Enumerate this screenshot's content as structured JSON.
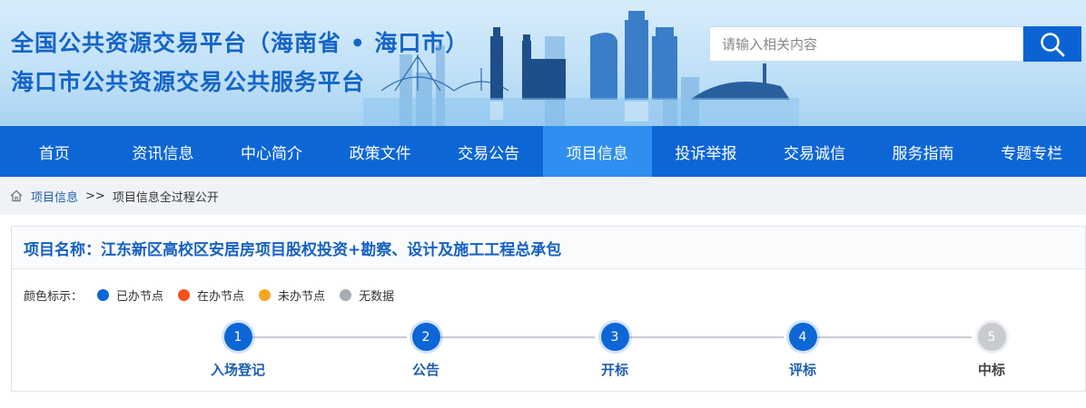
{
  "header": {
    "title_line1": "全国公共资源交易平台（海南省 • 海口市）",
    "title_line2": "海口市公共资源交易公共服务平台",
    "search_placeholder": "请输入相关内容",
    "search_icon": "search-icon"
  },
  "nav": {
    "items": [
      {
        "label": "首页"
      },
      {
        "label": "资讯信息"
      },
      {
        "label": "中心简介"
      },
      {
        "label": "政策文件"
      },
      {
        "label": "交易公告"
      },
      {
        "label": "项目信息",
        "active": true
      },
      {
        "label": "投诉举报"
      },
      {
        "label": "交易诚信"
      },
      {
        "label": "服务指南"
      },
      {
        "label": "专题专栏"
      }
    ]
  },
  "breadcrumb": {
    "home_icon": "home-icon",
    "link": "项目信息",
    "separator": ">>",
    "current": "项目信息全过程公开"
  },
  "project": {
    "title": "项目名称：江东新区高校区安居房项目股权投资+勘察、设计及施工工程总承包"
  },
  "legend": {
    "label": "颜色标示：",
    "items": [
      {
        "text": "已办节点",
        "color": "#0d66d6"
      },
      {
        "text": "在办节点",
        "color": "#f4511e"
      },
      {
        "text": "未办节点",
        "color": "#f5a623"
      },
      {
        "text": "无数据",
        "color": "#a6adb4"
      }
    ]
  },
  "steps": [
    {
      "num": "1",
      "label": "入场登记",
      "status": "done"
    },
    {
      "num": "2",
      "label": "公告",
      "status": "done"
    },
    {
      "num": "3",
      "label": "开标",
      "status": "done"
    },
    {
      "num": "4",
      "label": "评标",
      "status": "done"
    },
    {
      "num": "5",
      "label": "中标",
      "status": "none"
    }
  ],
  "colors": {
    "primary": "#0d66d6",
    "nav_active": "#2e8ff0",
    "link": "#1d5fb0",
    "pending_grey": "#c8cbcf"
  }
}
